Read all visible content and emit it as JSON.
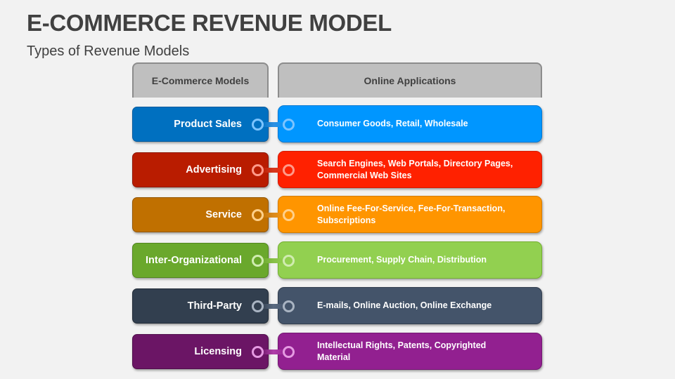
{
  "header": {
    "title": "E-COMMERCE REVENUE MODEL",
    "subtitle": "Types of Revenue Models"
  },
  "table": {
    "columns": [
      "E-Commerce Models",
      "Online Applications"
    ],
    "rows": [
      {
        "model": "Product Sales",
        "applications": "Consumer Goods, Retail, Wholesale",
        "colors": {
          "model": "#0070c0",
          "model_border": "#005a9e",
          "app": "#0096ff",
          "app_border": "#0078d4",
          "ring": "#7cc4ff",
          "link": "#2d8fe0"
        }
      },
      {
        "model": "Advertising",
        "applications": "Search Engines, Web Portals, Directory Pages, Commercial Web Sites",
        "colors": {
          "model": "#b91c00",
          "model_border": "#8f1600",
          "app": "#ff2100",
          "app_border": "#d41a00",
          "ring": "#ff9a8a",
          "link": "#d43a20"
        }
      },
      {
        "model": "Service",
        "applications": "Online Fee-For-Service, Fee-For-Transaction, Subscriptions",
        "colors": {
          "model": "#c07000",
          "model_border": "#945600",
          "app": "#ff9500",
          "app_border": "#d47c00",
          "ring": "#ffd08a",
          "link": "#d98a20"
        }
      },
      {
        "model": "Inter-Organizational",
        "applications": "Procurement, Supply Chain, Distribution",
        "colors": {
          "model": "#6aa82c",
          "model_border": "#528620",
          "app": "#92d050",
          "app_border": "#74b030",
          "ring": "#d0ecb0",
          "link": "#88c048"
        }
      },
      {
        "model": "Third-Party",
        "applications": "E-mails, Online Auction, Online Exchange",
        "colors": {
          "model": "#323f4f",
          "model_border": "#222c38",
          "app": "#44546a",
          "app_border": "#333f50",
          "ring": "#a9b4c2",
          "link": "#5a6a80"
        }
      },
      {
        "model": "Licensing",
        "applications": "Intellectual Rights, Patents, Copyrighted Material",
        "colors": {
          "model": "#6b1565",
          "model_border": "#4f0f4b",
          "app": "#922090",
          "app_border": "#731872",
          "ring": "#e59ae2",
          "link": "#b040aa"
        }
      }
    ]
  }
}
